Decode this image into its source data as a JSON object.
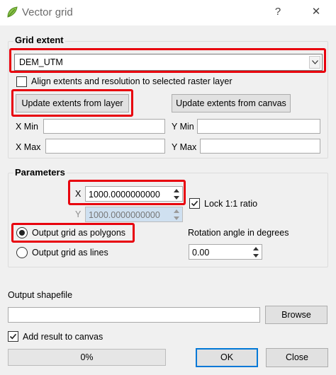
{
  "window": {
    "title": "Vector grid",
    "help_glyph": "?",
    "close_glyph": "✕"
  },
  "grid_extent": {
    "title": "Grid extent",
    "layer_select": {
      "value": "DEM_UTM"
    },
    "align_checkbox": {
      "label": "Align extents and resolution to selected raster layer",
      "checked": false
    },
    "update_from_layer_label": "Update extents from layer",
    "update_from_canvas_label": "Update extents from canvas",
    "xmin_label": "X Min",
    "ymin_label": "Y Min",
    "xmax_label": "X Max",
    "ymax_label": "Y Max",
    "xmin_value": "",
    "ymin_value": "",
    "xmax_value": "",
    "ymax_value": ""
  },
  "parameters": {
    "title": "Parameters",
    "x_label": "X",
    "x_value": "1000.0000000000",
    "y_label": "Y",
    "y_value": "1000.0000000000",
    "lock_label": "Lock 1:1 ratio",
    "lock_checked": true,
    "polygons_label": "Output grid as polygons",
    "lines_label": "Output grid as lines",
    "selected_output": "polygons",
    "rotation_label": "Rotation angle in degrees",
    "rotation_value": "0.00"
  },
  "output": {
    "label": "Output shapefile",
    "path_value": "",
    "browse_label": "Browse",
    "add_result_label": "Add result to canvas",
    "add_result_checked": true
  },
  "footer": {
    "progress_text": "0%",
    "progress_value": 0,
    "ok_label": "OK",
    "close_label": "Close"
  },
  "colors": {
    "highlight": "#e8000d",
    "default_button_border": "#0078d7",
    "disabled_field": "#cfe0f0"
  }
}
